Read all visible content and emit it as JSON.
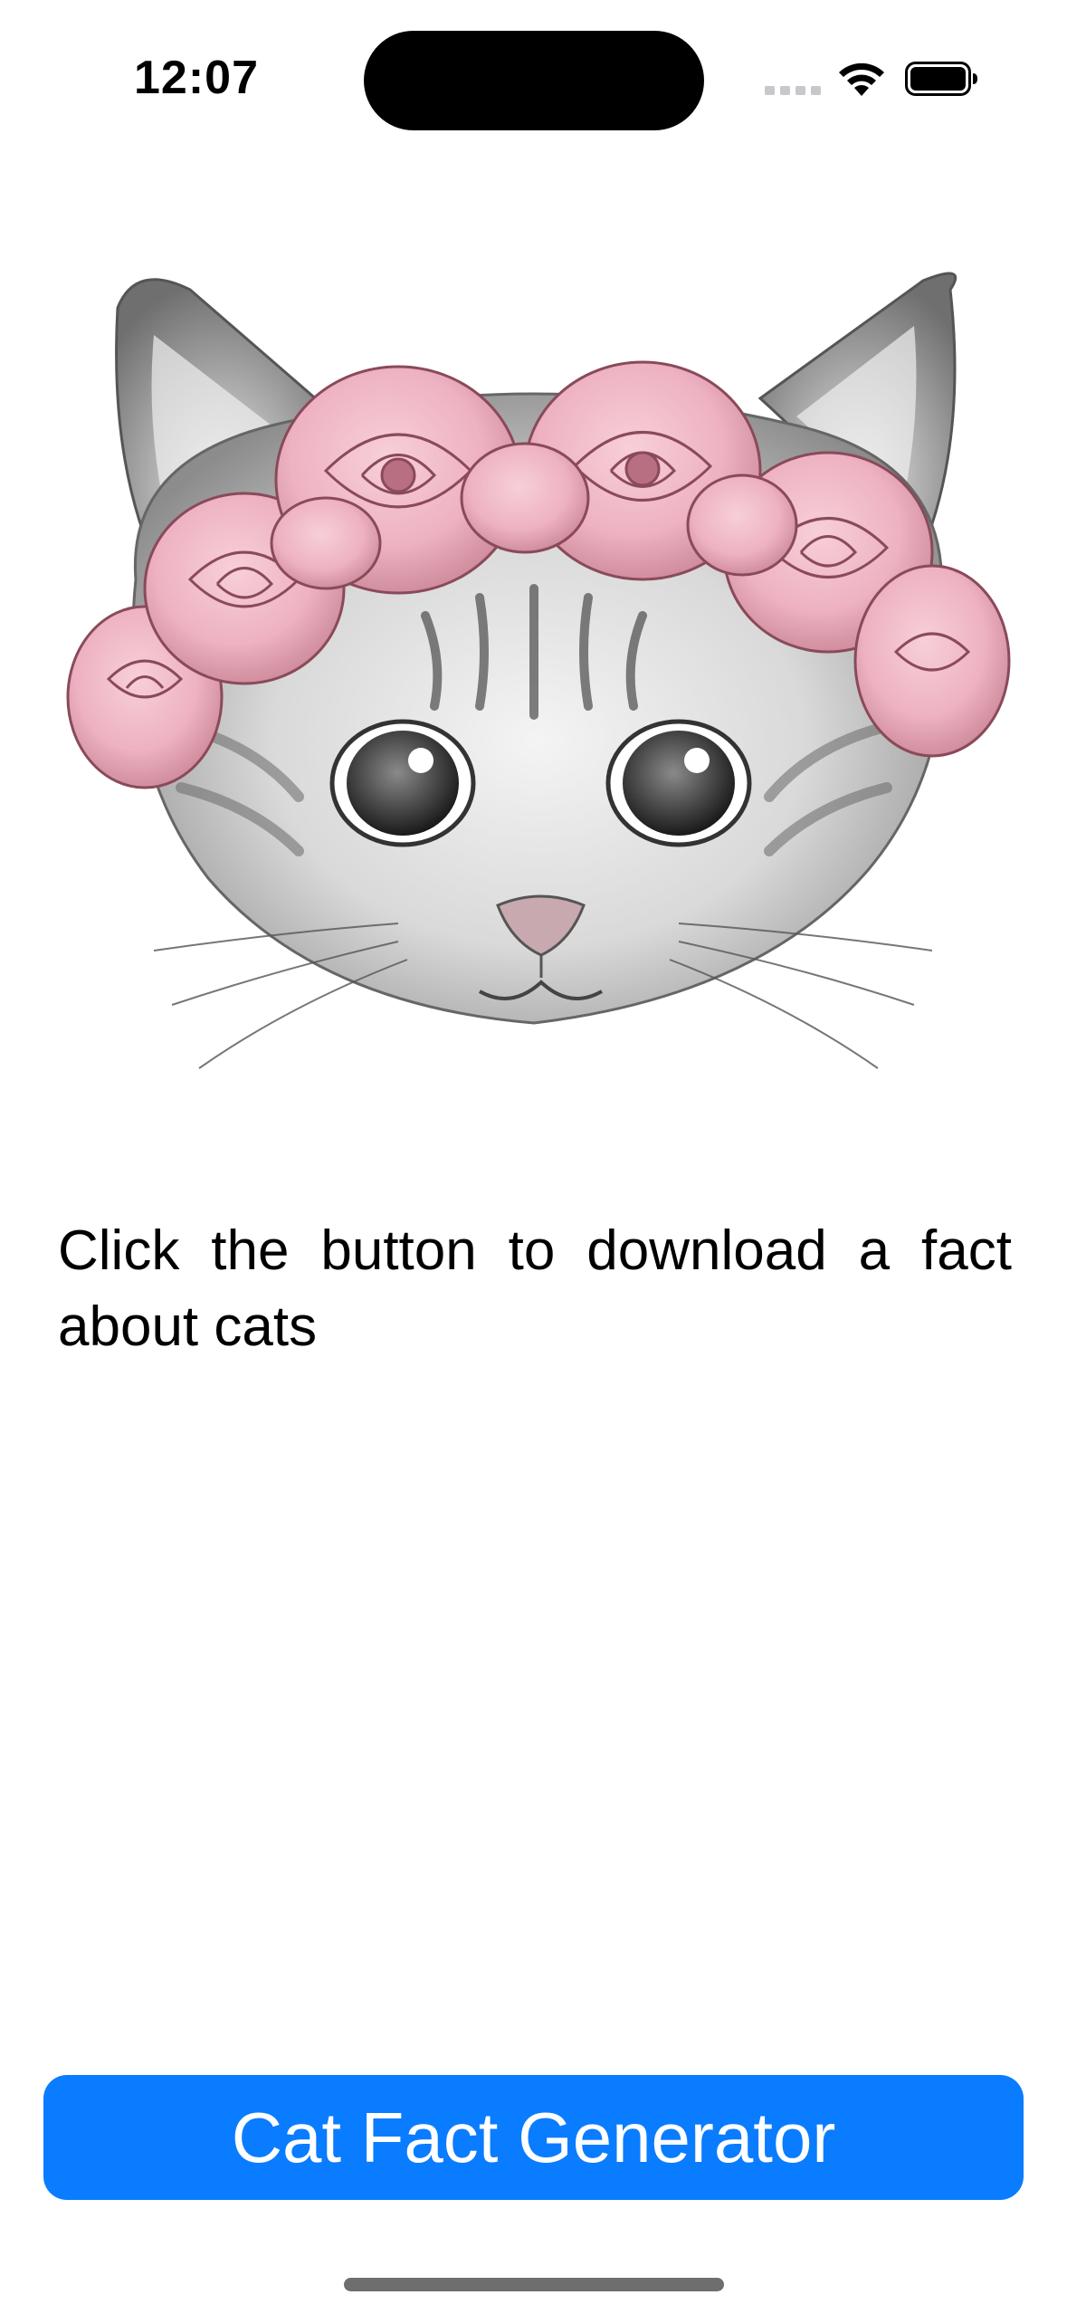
{
  "status_bar": {
    "time": "12:07"
  },
  "icons": {
    "wifi": "wifi-icon",
    "battery": "battery-icon",
    "cellular": "cellular-signal-icon"
  },
  "content": {
    "fact_text": "Click the button to download a fact about cats"
  },
  "button": {
    "label": "Cat Fact Generator"
  },
  "colors": {
    "accent": "#0a7cff",
    "background": "#ffffff",
    "text": "#000000",
    "rose": "#f2b8c6"
  }
}
